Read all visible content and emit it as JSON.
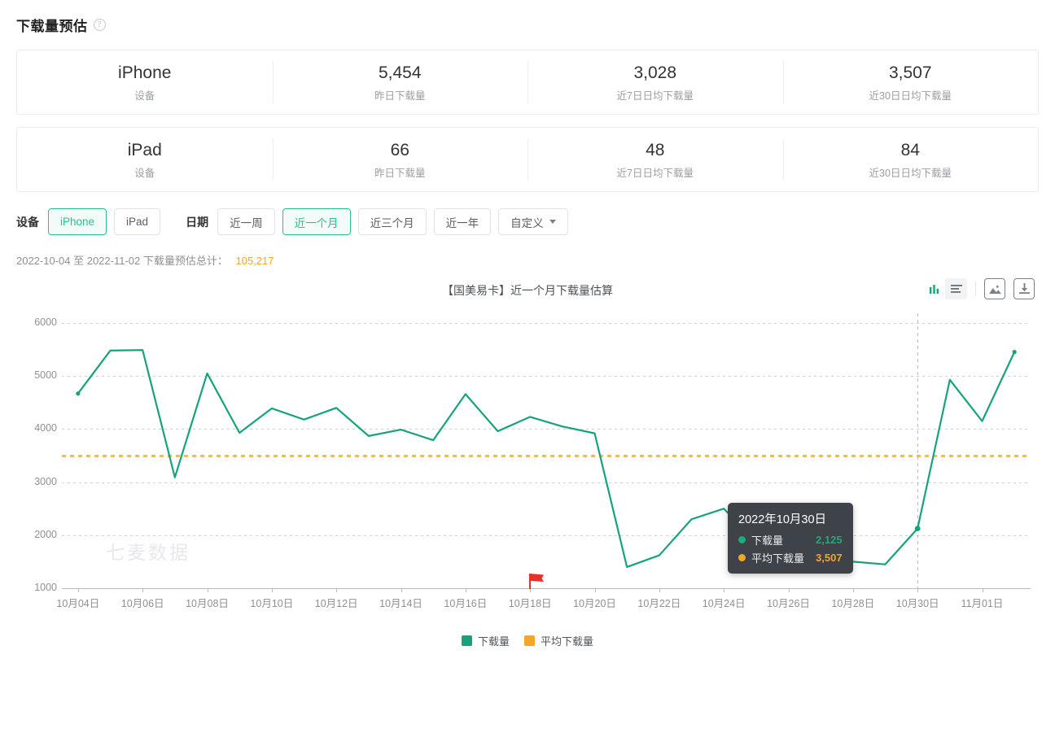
{
  "header": {
    "title": "下载量预估",
    "help_icon": "question-mark-icon"
  },
  "stat_cards": [
    {
      "cells": [
        {
          "value": "iPhone",
          "label": "设备"
        },
        {
          "value": "5,454",
          "label": "昨日下载量"
        },
        {
          "value": "3,028",
          "label": "近7日日均下载量"
        },
        {
          "value": "3,507",
          "label": "近30日日均下载量"
        }
      ]
    },
    {
      "cells": [
        {
          "value": "iPad",
          "label": "设备"
        },
        {
          "value": "66",
          "label": "昨日下载量"
        },
        {
          "value": "48",
          "label": "近7日日均下载量"
        },
        {
          "value": "84",
          "label": "近30日日均下载量"
        }
      ]
    }
  ],
  "filters": {
    "device_label": "设备",
    "device_options": [
      {
        "label": "iPhone",
        "active": true
      },
      {
        "label": "iPad",
        "active": false
      }
    ],
    "date_label": "日期",
    "date_options": [
      {
        "label": "近一周",
        "active": false
      },
      {
        "label": "近一个月",
        "active": true
      },
      {
        "label": "近三个月",
        "active": false
      },
      {
        "label": "近一年",
        "active": false
      }
    ],
    "custom_label": "自定义"
  },
  "summary": {
    "range_text": "2022-10-04 至 2022-11-02 下载量预估总计：",
    "total": "105,217"
  },
  "chart_tools": {
    "view_chart": "bar-chart-icon",
    "view_table": "list-view-icon",
    "save_image": "image-icon",
    "download": "download-icon"
  },
  "watermark": "七麦数据",
  "tooltip": {
    "title": "2022年10月30日",
    "rows": [
      {
        "name": "下载量",
        "value": "2,125",
        "color": "#1fa97d"
      },
      {
        "name": "平均下载量",
        "value": "3,507",
        "color": "#f5a623"
      }
    ]
  },
  "colors": {
    "series": "#16a37b",
    "average": "#f5bc42",
    "accent_green": "#2bbf91",
    "accent_orange": "#f5a623",
    "flag": "#e8302a"
  },
  "chart_data": {
    "type": "line",
    "title": "【国美易卡】近一个月下载量估算",
    "xlabel": "",
    "ylabel": "",
    "ylim": [
      1000,
      6000
    ],
    "yticks": [
      "1000",
      "2000",
      "3000",
      "4000",
      "5000",
      "6000"
    ],
    "grid": true,
    "legend_position": "bottom",
    "legend": [
      "下载量",
      "平均下载量"
    ],
    "x": [
      "10月04日",
      "10月05日",
      "10月06日",
      "10月07日",
      "10月08日",
      "10月09日",
      "10月10日",
      "10月11日",
      "10月12日",
      "10月13日",
      "10月14日",
      "10月15日",
      "10月16日",
      "10月17日",
      "10月18日",
      "10月19日",
      "10月20日",
      "10月21日",
      "10月22日",
      "10月23日",
      "10月24日",
      "10月25日",
      "10月26日",
      "10月27日",
      "10月28日",
      "10月29日",
      "10月30日",
      "10月31日",
      "11月01日",
      "11月02日"
    ],
    "xtick_labels": [
      "10月04日",
      "10月06日",
      "10月08日",
      "10月10日",
      "10月12日",
      "10月14日",
      "10月16日",
      "10月18日",
      "10月20日",
      "10月22日",
      "10月24日",
      "10月26日",
      "10月28日",
      "10月30日",
      "11月01日"
    ],
    "series": [
      {
        "name": "下载量",
        "type": "line",
        "color": "#16a37b",
        "values": [
          4670,
          5480,
          5490,
          3090,
          5050,
          3930,
          4390,
          4180,
          4400,
          3870,
          3990,
          3790,
          4660,
          3960,
          4230,
          4050,
          3920,
          1400,
          1620,
          2300,
          2500,
          1870,
          1700,
          1640,
          1500,
          1450,
          2125,
          4930,
          4150,
          5454
        ]
      },
      {
        "name": "平均下载量",
        "type": "constant-line",
        "color": "#f5bc42",
        "value": 3507
      }
    ],
    "markers": [
      {
        "type": "flag",
        "x": "10月18日",
        "color": "#e8302a"
      },
      {
        "type": "vertical-dashed",
        "x": "10月30日",
        "color": "#b7babd"
      }
    ],
    "highlighted_point": {
      "x": "10月30日",
      "y": 2125
    },
    "total": 105217
  }
}
